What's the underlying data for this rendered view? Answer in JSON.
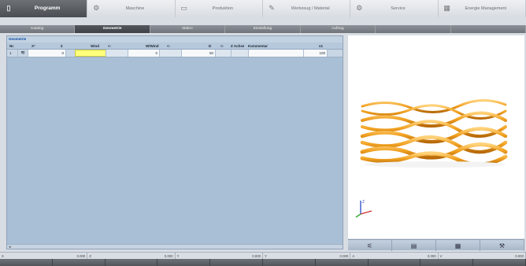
{
  "top_tabs": [
    {
      "label": "Programm",
      "icon": "document-icon"
    },
    {
      "label": "Maschine",
      "icon": "gears-icon"
    },
    {
      "label": "Produktion",
      "icon": "production-icon"
    },
    {
      "label": "Werkzeug / Material",
      "icon": "wrench-icon"
    },
    {
      "label": "Service",
      "icon": "service-icon"
    },
    {
      "label": "Energie Management",
      "icon": "energy-icon"
    }
  ],
  "sub_tabs": [
    "Katalog",
    "Geometrie",
    "Makro",
    "Einstellung",
    "Auftrag",
    "",
    ""
  ],
  "section_title": "Geometrie",
  "grid": {
    "headers": {
      "nr": "Nr.",
      "x": "X°",
      "sym": "Σ",
      "wind": "Wind",
      "arr1": "<-",
      "wwind": "W/Wind",
      "arr2": "<-",
      "d": "D",
      "arr3": "<-",
      "zachse": "Z Achse",
      "kommentar": "Kommentar",
      "v1": "v1"
    },
    "rows": [
      {
        "nr": "1",
        "x": "0",
        "wind": "",
        "wwind": "0",
        "d": "50",
        "kommentar": "",
        "v1": "100"
      }
    ]
  },
  "toolbar_icons": [
    "spring-view-icon",
    "machine-view-icon",
    "grid-view-icon",
    "tool-view-icon"
  ],
  "coordinates": [
    {
      "axis": "X",
      "value": "0.000"
    },
    {
      "axis": "Z",
      "value": "0.000"
    },
    {
      "axis": "Y",
      "value": "0.000"
    },
    {
      "axis": "Y",
      "value": "0.000"
    },
    {
      "axis": "A",
      "value": "0.000"
    },
    {
      "axis": "V",
      "value": "0.000"
    }
  ],
  "colors": {
    "active_tab": "#4a4e53",
    "panel_bg": "#a9bfd6",
    "input_highlight": "#ffff7a",
    "spring": "#f0a020"
  }
}
